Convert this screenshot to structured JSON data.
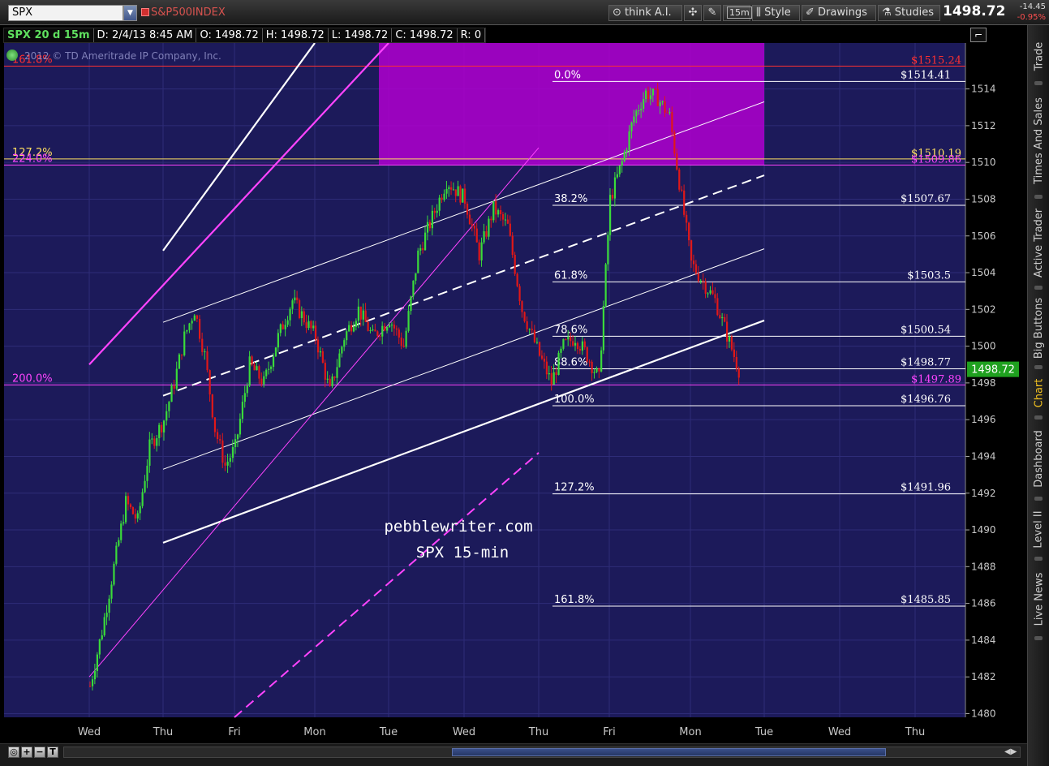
{
  "toolbar": {
    "symbol": "SPX",
    "symbol_description": "S&P500INDEX",
    "buttons": [
      {
        "id": "think-ai",
        "label": "think A.I.",
        "icon": "magnifier-icon"
      },
      {
        "id": "crosshair",
        "label": "",
        "icon": "crosshair-icon"
      },
      {
        "id": "tools",
        "label": "",
        "icon": "wrench-icon"
      },
      {
        "id": "timeframe",
        "label": "15m",
        "icon": ""
      },
      {
        "id": "style",
        "label": "Style",
        "icon": "bar-chart-icon"
      },
      {
        "id": "drawings",
        "label": "Drawings",
        "icon": "pencil-icon"
      },
      {
        "id": "studies",
        "label": "Studies",
        "icon": "flask-icon"
      }
    ],
    "last_price": "1498.72",
    "change": "-14.45",
    "change_pct": "-0.95%"
  },
  "header": {
    "chart_id": "SPX 20 d 15m",
    "datetime": "D: 2/4/13 8:45 AM",
    "open": "O: 1498.72",
    "high": "H: 1498.72",
    "low": "L: 1498.72",
    "close": "C: 1498.72",
    "range": "R: 0"
  },
  "copyright": "2012 © TD Ameritrade IP Company, Inc.",
  "watermark": {
    "line1": "pebblewriter.com",
    "line2": "SPX 15-min"
  },
  "sidebar": {
    "tabs": [
      "Trade",
      "Times And Sales",
      "Active Trader",
      "Big Buttons",
      "Chart",
      "Dashboard",
      "Level II",
      "Live News"
    ],
    "active": "Chart"
  },
  "colors": {
    "background": "#1c1a5a",
    "up": "#3adb3a",
    "down": "#e01818",
    "magenta": "#ff44ff",
    "zone": "#b000d0",
    "level_white": "#ffffff"
  },
  "chart_data": {
    "type": "candlestick",
    "title": "",
    "xlabel": "",
    "ylabel": "",
    "ylim": [
      1479.8,
      1516.5
    ],
    "y_ticks": [
      1480,
      1482,
      1484,
      1486,
      1488,
      1490,
      1492,
      1494,
      1496,
      1498,
      1500,
      1502,
      1504,
      1506,
      1508,
      1510,
      1512,
      1514
    ],
    "x_ticks": [
      "Wed",
      "Thu",
      "Fri",
      "Mon",
      "Tue",
      "Wed",
      "Thu",
      "Fri",
      "Mon",
      "Tue",
      "Wed",
      "Thu"
    ],
    "grid": true,
    "current_price_label": "1498.72",
    "price_path": [
      [
        "Wed",
        1481.5
      ],
      [
        "Wed",
        1484.5
      ],
      [
        "Wed",
        1488
      ],
      [
        "Wed",
        1491.5
      ],
      [
        "Wed",
        1490.5
      ],
      [
        "Wed",
        1494.5
      ],
      [
        "Thu",
        1496
      ],
      [
        "Thu",
        1498
      ],
      [
        "Thu",
        1500.5
      ],
      [
        "Thu",
        1502
      ],
      [
        "Thu",
        1499.5
      ],
      [
        "Thu",
        1495.5
      ],
      [
        "Thu",
        1493.5
      ],
      [
        "Fri",
        1494.5
      ],
      [
        "Fri",
        1499
      ],
      [
        "Fri",
        1498
      ],
      [
        "Fri",
        1500.5
      ],
      [
        "Fri",
        1502.5
      ],
      [
        "Mon",
        1500.5
      ],
      [
        "Mon",
        1497.5
      ],
      [
        "Mon",
        1500.5
      ],
      [
        "Mon",
        1502
      ],
      [
        "Mon",
        1500.5
      ],
      [
        "Tue",
        1501.5
      ],
      [
        "Tue",
        1500
      ],
      [
        "Tue",
        1505
      ],
      [
        "Tue",
        1507
      ],
      [
        "Tue",
        1509
      ],
      [
        "Wed",
        1508
      ],
      [
        "Wed",
        1505
      ],
      [
        "Wed",
        1507.5
      ],
      [
        "Wed",
        1506.5
      ],
      [
        "Wed",
        1502
      ],
      [
        "Thu",
        1499.5
      ],
      [
        "Thu",
        1498
      ],
      [
        "Thu",
        1500
      ],
      [
        "Thu",
        1500.5
      ],
      [
        "Thu",
        1499.5
      ],
      [
        "Thu",
        1498.2
      ],
      [
        "Fri",
        1508
      ],
      [
        "Fri",
        1510
      ],
      [
        "Fri",
        1512.5
      ],
      [
        "Fri",
        1513.8
      ],
      [
        "Fri",
        1513.5
      ],
      [
        "Fri",
        1512.5
      ],
      [
        "Mon",
        1504.5
      ],
      [
        "Mon",
        1502.5
      ],
      [
        "Mon",
        1498.72
      ]
    ],
    "fib_levels": [
      {
        "label": "0.0%",
        "value": 1514.41,
        "price_label": "$1514.41"
      },
      {
        "label": "38.2%",
        "value": 1507.67,
        "price_label": "$1507.67"
      },
      {
        "label": "61.8%",
        "value": 1503.5,
        "price_label": "$1503.5"
      },
      {
        "label": "78.6%",
        "value": 1500.54,
        "price_label": "$1500.54"
      },
      {
        "label": "88.6%",
        "value": 1498.77,
        "price_label": "$1498.77"
      },
      {
        "label": "100.0%",
        "value": 1496.76,
        "price_label": "$1496.76"
      },
      {
        "label": "127.2%",
        "value": 1491.96,
        "price_label": "$1491.96"
      },
      {
        "label": "161.8%",
        "value": 1485.85,
        "price_label": "$1485.85"
      }
    ],
    "horizontal_levels": [
      {
        "value": 1515.24,
        "price_label": "$1515.24",
        "left_label": "161.8%",
        "color": "#ff3030"
      },
      {
        "value": 1510.19,
        "price_label": "$1510.19",
        "left_label": "127.2%",
        "color": "#ffe060"
      },
      {
        "value": 1509.86,
        "price_label": "$1509.86",
        "left_label": "224.0%",
        "color": "#ff44ff"
      },
      {
        "value": 1497.89,
        "price_label": "$1497.89",
        "left_label": "200.0%",
        "color": "#ff44ff"
      }
    ],
    "zone": {
      "from": 1509.86,
      "to": 1516.5,
      "x_start": "Tue",
      "x_end": "Tue(2)"
    },
    "channel_lines": [
      {
        "color": "#ffffff",
        "width": 2.2,
        "dash": "",
        "from": [
          "Thu",
          1505.2
        ],
        "to": [
          "Mon",
          1516.5
        ]
      },
      {
        "color": "#ffffff",
        "width": 1,
        "dash": "",
        "from": [
          "Thu",
          1501.3
        ],
        "to": [
          "Tue(2)",
          1513.3
        ]
      },
      {
        "color": "#ffffff",
        "width": 2,
        "dash": "12 7",
        "from": [
          "Thu",
          1497.3
        ],
        "to": [
          "Tue(2)",
          1509.3
        ]
      },
      {
        "color": "#ffffff",
        "width": 1,
        "dash": "",
        "from": [
          "Thu",
          1493.3
        ],
        "to": [
          "Tue(2)",
          1505.3
        ]
      },
      {
        "color": "#ffffff",
        "width": 2.2,
        "dash": "",
        "from": [
          "Thu",
          1489.3
        ],
        "to": [
          "Tue(2)",
          1501.4
        ]
      },
      {
        "color": "#ff44ff",
        "width": 2.2,
        "dash": "",
        "from": [
          "Wed",
          1499
        ],
        "to": [
          "Tue",
          1516.5
        ]
      },
      {
        "color": "#ff44ff",
        "width": 1,
        "dash": "",
        "from": [
          "Wed",
          1482
        ],
        "to": [
          "Thu(2)",
          1510.8
        ]
      },
      {
        "color": "#ff44ff",
        "width": 2,
        "dash": "12 7",
        "from": [
          "Fri",
          1479.8
        ],
        "to": [
          "Thu(2)",
          1494.2
        ]
      }
    ]
  }
}
